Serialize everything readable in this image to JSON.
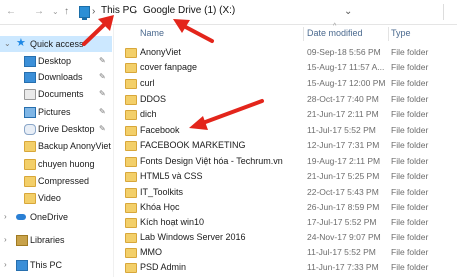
{
  "address": {
    "crumbs": [
      "This PC",
      "Google Drive (1) (X:)"
    ]
  },
  "sidebar": [
    {
      "label": "Quick access",
      "icon": "star-icon",
      "selected": true
    },
    {
      "label": "Desktop",
      "icon": "desktop-icon",
      "pinned": true
    },
    {
      "label": "Downloads",
      "icon": "downloads-icon",
      "pinned": true
    },
    {
      "label": "Documents",
      "icon": "documents-icon",
      "pinned": true
    },
    {
      "label": "Pictures",
      "icon": "pictures-icon",
      "pinned": true
    },
    {
      "label": "Drive Desktop",
      "icon": "drive-icon",
      "pinned": true
    },
    {
      "label": "Backup AnonyViet",
      "icon": "folder-icon"
    },
    {
      "label": "chuyen huong",
      "icon": "folder-icon"
    },
    {
      "label": "Compressed",
      "icon": "folder-icon"
    },
    {
      "label": "Video",
      "icon": "folder-icon"
    },
    {
      "label": "OneDrive",
      "icon": "onedrive-icon"
    },
    {
      "label": "Libraries",
      "icon": "libraries-icon"
    },
    {
      "label": "This PC",
      "icon": "pc-icon"
    }
  ],
  "columns": {
    "name": "Name",
    "date": "Date modified",
    "type": "Type"
  },
  "files": [
    {
      "name": "AnonyViet",
      "date": "09-Sep-18 5:56 PM",
      "type": "File folder"
    },
    {
      "name": "cover fanpage",
      "date": "15-Aug-17 11:57 A...",
      "type": "File folder"
    },
    {
      "name": "curl",
      "date": "15-Aug-17 12:00 PM",
      "type": "File folder"
    },
    {
      "name": "DDOS",
      "date": "28-Oct-17 7:40 PM",
      "type": "File folder"
    },
    {
      "name": "dich",
      "date": "21-Jun-17 2:11 PM",
      "type": "File folder"
    },
    {
      "name": "Facebook",
      "date": "11-Jul-17 5:52 PM",
      "type": "File folder"
    },
    {
      "name": "FACEBOOK MARKETING",
      "date": "12-Jun-17 7:31 PM",
      "type": "File folder"
    },
    {
      "name": "Fonts Design Việt hóa - Techrum.vn",
      "date": "19-Aug-17 2:11 PM",
      "type": "File folder"
    },
    {
      "name": "HTML5 và CSS",
      "date": "21-Jun-17 5:25 PM",
      "type": "File folder"
    },
    {
      "name": "IT_Toolkits",
      "date": "22-Oct-17 5:43 PM",
      "type": "File folder"
    },
    {
      "name": "Khóa Học",
      "date": "26-Jun-17 8:59 PM",
      "type": "File folder"
    },
    {
      "name": "Kích hoạt win10",
      "date": "17-Jul-17 5:52 PM",
      "type": "File folder"
    },
    {
      "name": "Lab Windows Server 2016",
      "date": "24-Nov-17 9:07 PM",
      "type": "File folder"
    },
    {
      "name": "MMO",
      "date": "11-Jul-17 5:52 PM",
      "type": "File folder"
    },
    {
      "name": "PSD Admin",
      "date": "11-Jun-17 7:33 PM",
      "type": "File folder"
    }
  ],
  "colors": {
    "selected": "#cce8ff",
    "folder": "#f3cf69",
    "header": "#4b6a8f",
    "arrow": "#e3251b"
  }
}
